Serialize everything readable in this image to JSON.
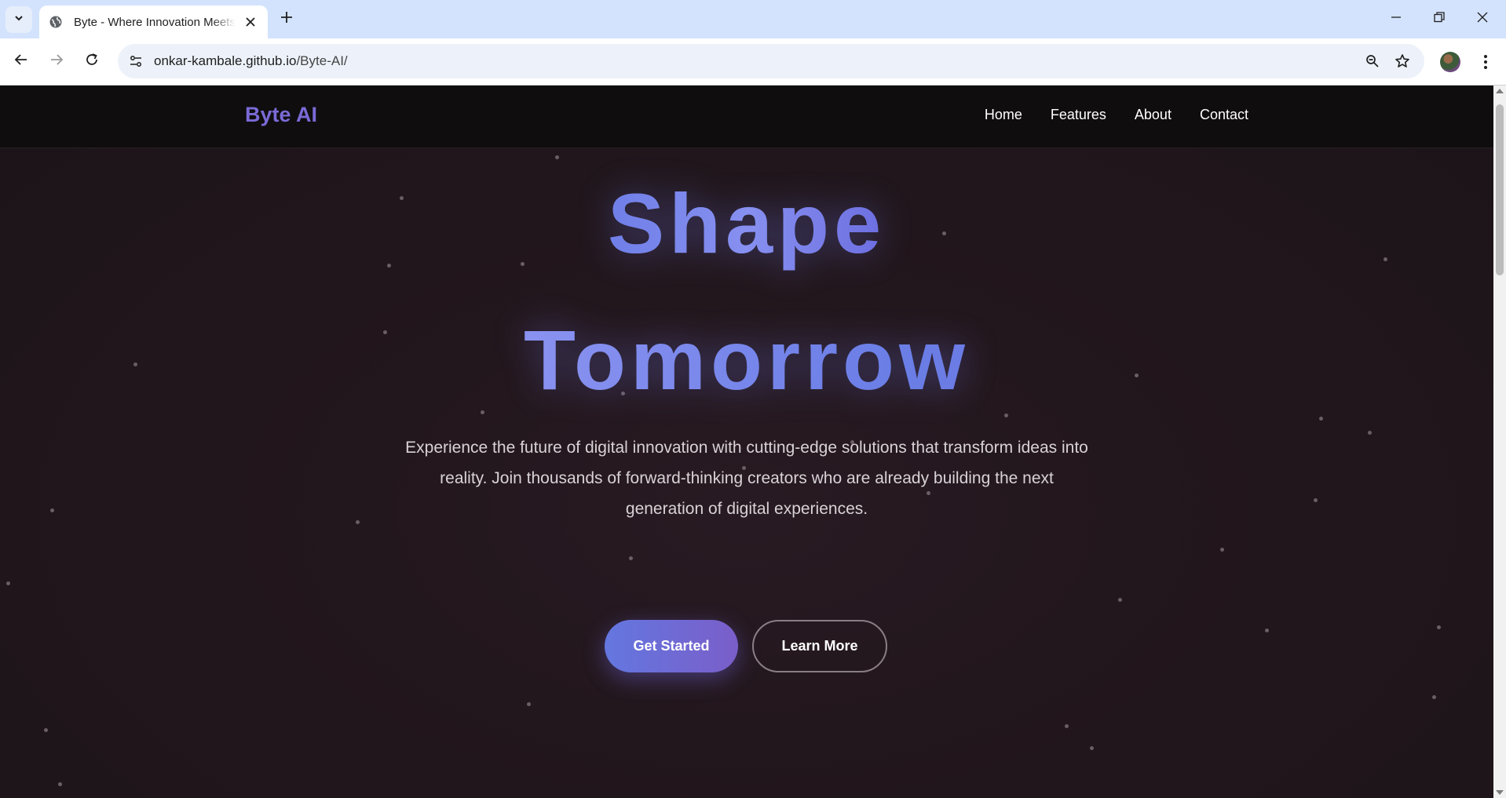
{
  "browser": {
    "tab_title": "Byte - Where Innovation Meets",
    "url_host": "onkar-kambale.github.io",
    "url_path": "/Byte-AI/",
    "icons": [
      "chevron-down-icon",
      "globe-icon",
      "close-icon",
      "plus-icon",
      "minimize-icon",
      "restore-icon",
      "window-close-icon",
      "back-arrow-icon",
      "forward-arrow-icon",
      "reload-icon",
      "site-info-icon",
      "zoom-icon",
      "star-icon",
      "profile-avatar",
      "kebab-menu-icon"
    ]
  },
  "site": {
    "brand": "Byte AI",
    "brand_color": "#7a6ad6",
    "nav": [
      "Home",
      "Features",
      "About",
      "Contact"
    ]
  },
  "hero": {
    "headline_line1": "Shape",
    "headline_line2": "Tomorrow",
    "subtitle_line1": "Experience the future of digital innovation with cutting-edge solutions that transform ideas into",
    "subtitle_line2": "reality. Join thousands of forward-thinking creators who are already building the next",
    "subtitle_line3": "generation of digital experiences.",
    "primary_button": "Get Started",
    "secondary_button": "Learn More",
    "accent_gradient": [
      "#6477e0",
      "#7a5ec9"
    ]
  }
}
